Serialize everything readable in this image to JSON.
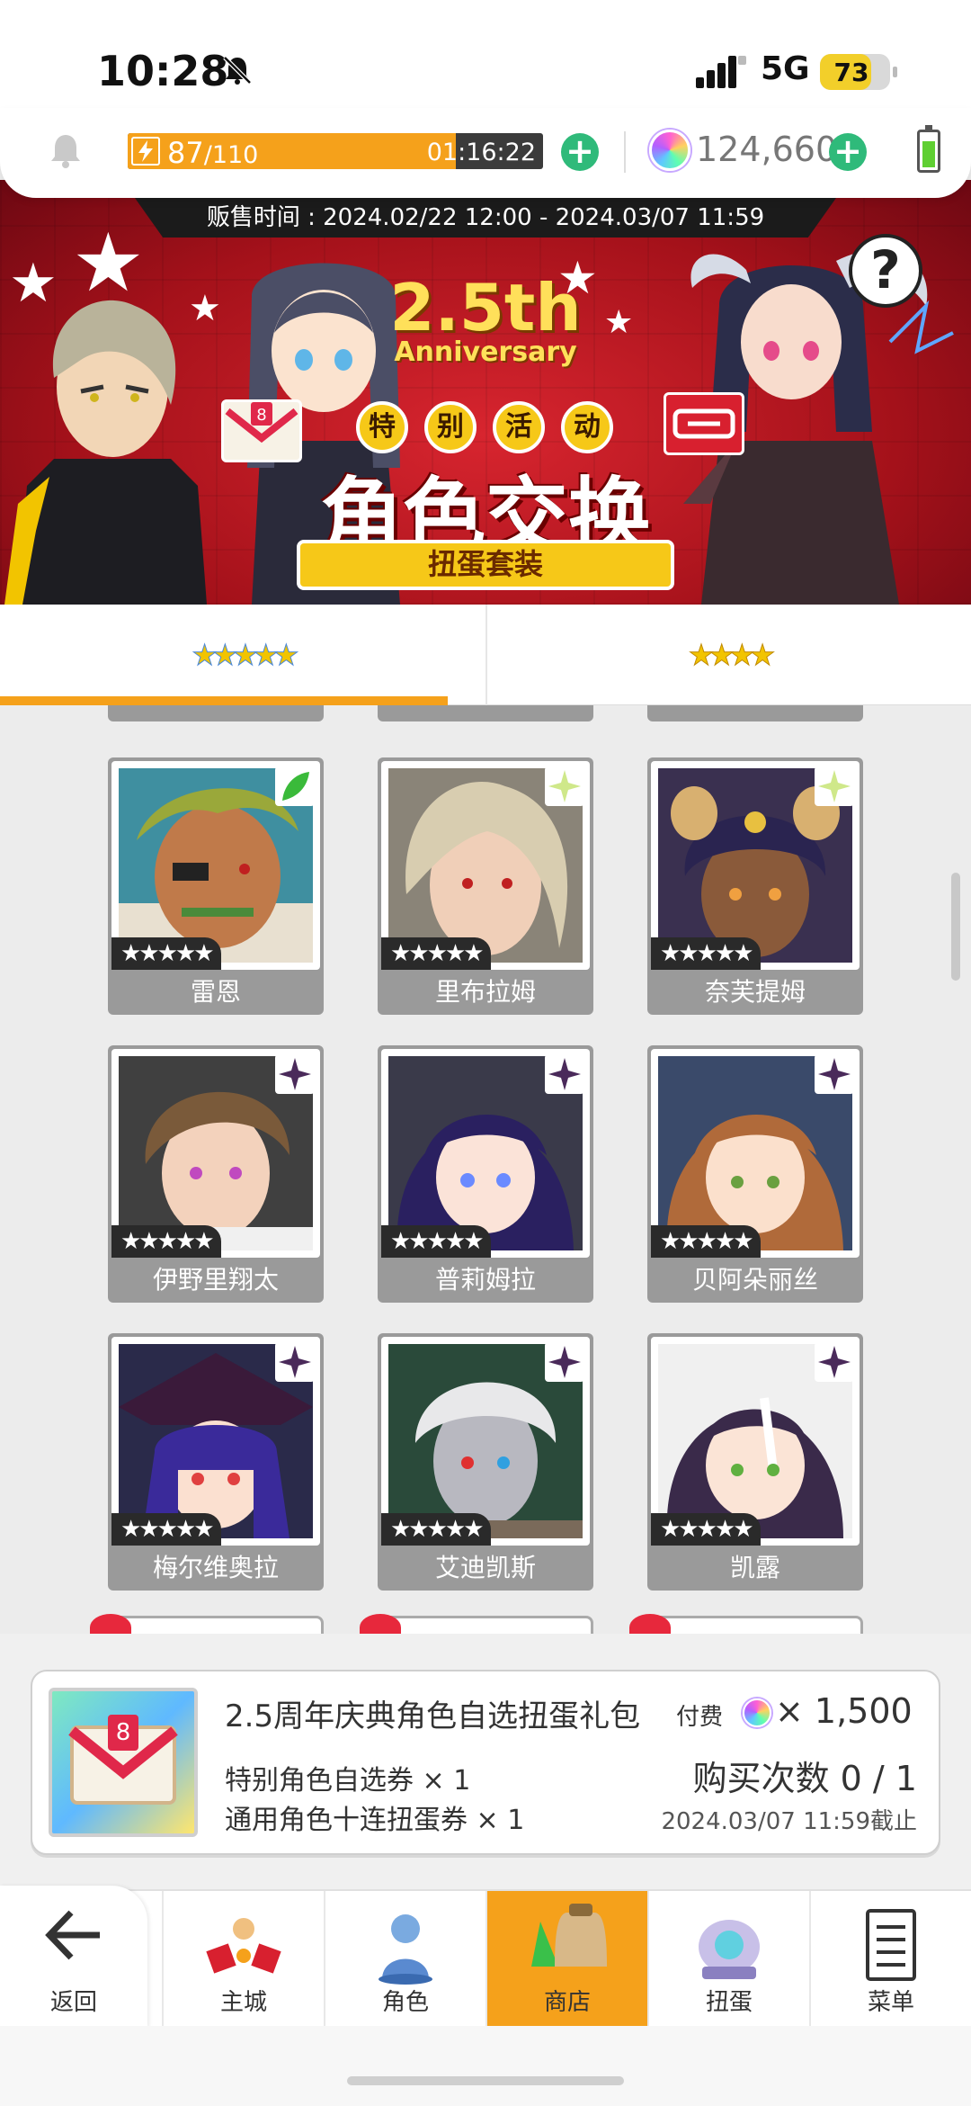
{
  "status_bar": {
    "time": "10:28",
    "network": "5G",
    "battery": "73",
    "battery_level": 0.73
  },
  "resources": {
    "stamina_current": "87",
    "stamina_max": "/110",
    "stamina_fill": 0.79,
    "stamina_timer": "01:16:22",
    "gems": "124,660"
  },
  "banner": {
    "sale_period": "贩售时间 : 2024.02/22 12:00 - 2024.03/07 11:59",
    "anniversary_number": "2.5th",
    "anniversary_word": "Anniversary",
    "event_label": [
      "特",
      "别",
      "活",
      "动"
    ],
    "title": "角色交换",
    "subtitle": "扭蛋套装",
    "help_symbol": "?"
  },
  "rarity_tabs": [
    {
      "label": "★★★★★",
      "selected": true
    },
    {
      "label": "★★★★",
      "selected": false
    }
  ],
  "characters": [
    {
      "name": "雷恩",
      "stars": "★★★★★",
      "badge": "green-leaf"
    },
    {
      "name": "里布拉姆",
      "stars": "★★★★★",
      "badge": "green-sparkle"
    },
    {
      "name": "奈芙提姆",
      "stars": "★★★★★",
      "badge": "green-sparkle"
    },
    {
      "name": "伊野里翔太",
      "stars": "★★★★★",
      "badge": "purple-sparkle"
    },
    {
      "name": "普莉姆拉",
      "stars": "★★★★★",
      "badge": "purple-sparkle"
    },
    {
      "name": "贝阿朵丽丝",
      "stars": "★★★★★",
      "badge": "purple-sparkle"
    },
    {
      "name": "梅尔维奥拉",
      "stars": "★★★★★",
      "badge": "purple-sparkle"
    },
    {
      "name": "艾迪凯斯",
      "stars": "★★★★★",
      "badge": "purple-sparkle"
    },
    {
      "name": "凯露",
      "stars": "★★★★★",
      "badge": "purple-sparkle"
    }
  ],
  "item": {
    "title": "2.5周年庆典角色自选扭蛋礼包",
    "paid_label": "付费",
    "price": "× 1,500",
    "line1": "特别角色自选券 × 1",
    "line2": "通用角色十连扭蛋券 × 1",
    "buy_count": "购买次数 0 / 1",
    "deadline": "2024.03/07 11:59截止"
  },
  "nav": {
    "back": "返回",
    "castle": "主城",
    "character": "角色",
    "shop": "商店",
    "gacha": "扭蛋",
    "menu": "菜单"
  },
  "colors": {
    "accent": "#f5a11b",
    "plus": "#2fba7a",
    "banner_red": "#c41c26"
  }
}
